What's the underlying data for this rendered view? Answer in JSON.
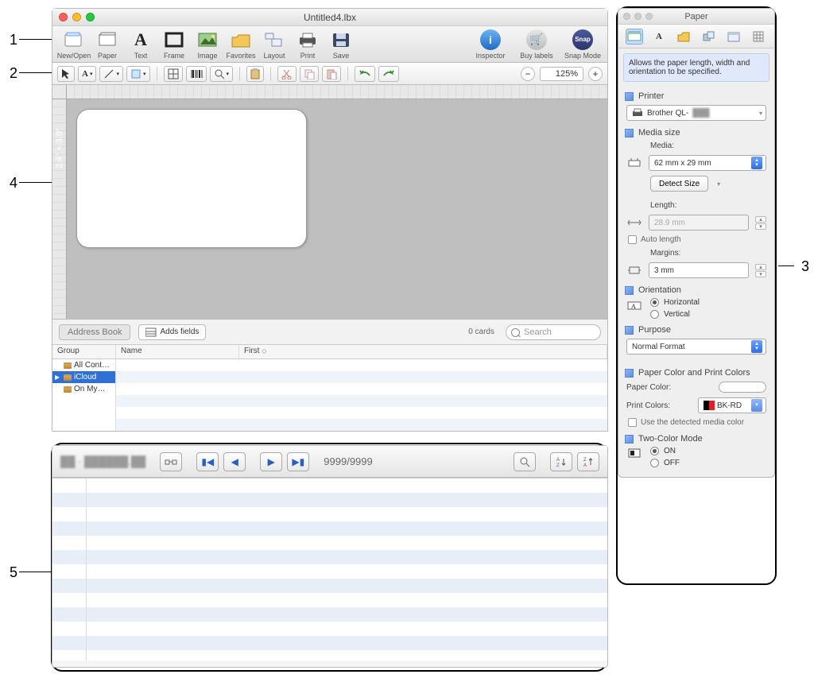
{
  "callouts": {
    "n1": "1",
    "n2": "2",
    "n3": "3",
    "n4": "4",
    "n5": "5"
  },
  "window": {
    "title": "Untitled4.lbx"
  },
  "toolbar1": {
    "items": [
      {
        "label": "New/Open",
        "icon": "newopen"
      },
      {
        "label": "Paper",
        "icon": "paper"
      },
      {
        "label": "Text",
        "icon": "text"
      },
      {
        "label": "Frame",
        "icon": "frame"
      },
      {
        "label": "Image",
        "icon": "image"
      },
      {
        "label": "Favorites",
        "icon": "fav"
      },
      {
        "label": "Layout",
        "icon": "layout"
      },
      {
        "label": "Print",
        "icon": "print"
      },
      {
        "label": "Save",
        "icon": "save"
      }
    ],
    "right": [
      {
        "label": "Inspector",
        "icon": "info"
      },
      {
        "label": "Buy labels",
        "icon": "cart"
      },
      {
        "label": "Snap Mode",
        "icon": "snap"
      }
    ]
  },
  "toolbar2": {
    "zoom": "125%"
  },
  "canvas": {
    "dim": "2.4\"\n× 3.9\""
  },
  "addrStrip": {
    "tab": "Address Book",
    "addFields": "Adds fields",
    "cards": "0 cards",
    "searchPlaceholder": "Search"
  },
  "gridHead": {
    "group": "Group",
    "name": "Name",
    "first": "First"
  },
  "groups": [
    {
      "label": "All Cont…",
      "sel": false,
      "arrow": false
    },
    {
      "label": "iCloud",
      "sel": true,
      "arrow": true
    },
    {
      "label": "On My…",
      "sel": false,
      "arrow": false
    }
  ],
  "datasheet": {
    "counter": "9999/9999"
  },
  "inspector": {
    "title": "Paper",
    "desc": "Allows the paper length, width and orientation to be specified.",
    "printerHdr": "Printer",
    "printer": "Brother QL-",
    "mediaHdr": "Media size",
    "mediaLabel": "Media:",
    "media": "62 mm x 29 mm",
    "detect": "Detect Size",
    "lengthLabel": "Length:",
    "length": "28.9 mm",
    "autoLen": "Auto length",
    "marginsLabel": "Margins:",
    "margins": "3 mm",
    "orientHdr": "Orientation",
    "horiz": "Horizontal",
    "vert": "Vertical",
    "purposeHdr": "Purpose",
    "purpose": "Normal Format",
    "colorsHdr": "Paper Color and Print Colors",
    "paperColorLbl": "Paper Color:",
    "printColorsLbl": "Print Colors:",
    "printColors": "BK-RD",
    "detectedChk": "Use the detected media color",
    "twoColorHdr": "Two-Color Mode",
    "on": "ON",
    "off": "OFF"
  }
}
